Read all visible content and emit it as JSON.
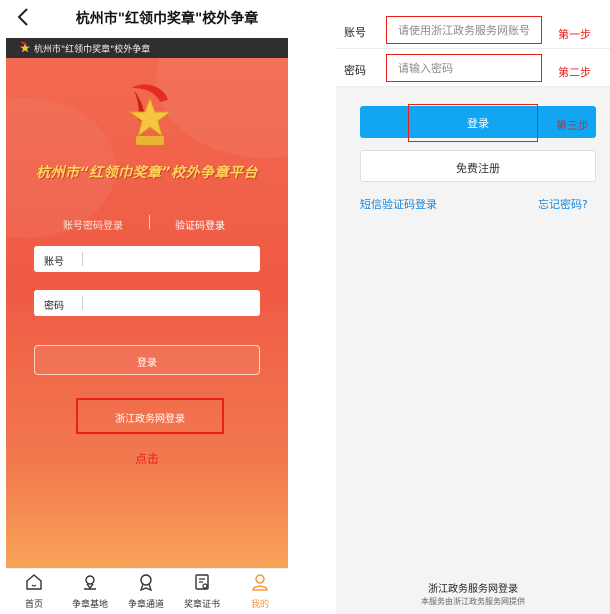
{
  "left": {
    "header": {
      "title": "杭州市\"红领巾奖章\"校外争章"
    },
    "subbar": {
      "title": "杭州市\"红领巾奖章\"校外争章"
    },
    "platform_title": "杭州市“红领巾奖章”校外争章平台",
    "tabs": [
      {
        "label": "账号密码登录"
      },
      {
        "label": "验证码登录"
      }
    ],
    "fields": {
      "account_label": "账号",
      "password_label": "密码"
    },
    "login_label": "登录",
    "zj_login_label": "浙江政务网登录",
    "click_hint": "点击",
    "nav": [
      {
        "label": "首页",
        "icon": "home-icon"
      },
      {
        "label": "争章基地",
        "icon": "location-icon"
      },
      {
        "label": "争章通道",
        "icon": "medal-icon"
      },
      {
        "label": "奖章证书",
        "icon": "certificate-icon"
      },
      {
        "label": "我的",
        "icon": "user-icon"
      }
    ],
    "active_nav": "我的"
  },
  "right": {
    "account": {
      "label": "账号",
      "placeholder": "请使用浙江政务服务网账号",
      "step": "第一步"
    },
    "password": {
      "label": "密码",
      "placeholder": "请输入密码",
      "step": "第二步"
    },
    "login_label": "登录",
    "step3": "第三步",
    "register_label": "免费注册",
    "sms_login": "短信验证码登录",
    "forgot_password": "忘记密码?",
    "footer_title": "浙江政务服务网登录",
    "footer_note": "本服务由浙江政务服务网提供"
  },
  "colors": {
    "hero": "#ef5a45",
    "accent_blue": "#12a5f2",
    "annotation_red": "#e8201a",
    "title_gold": "#ffd65a",
    "link_blue": "#1a86d8",
    "nav_active": "#f29a3c"
  }
}
